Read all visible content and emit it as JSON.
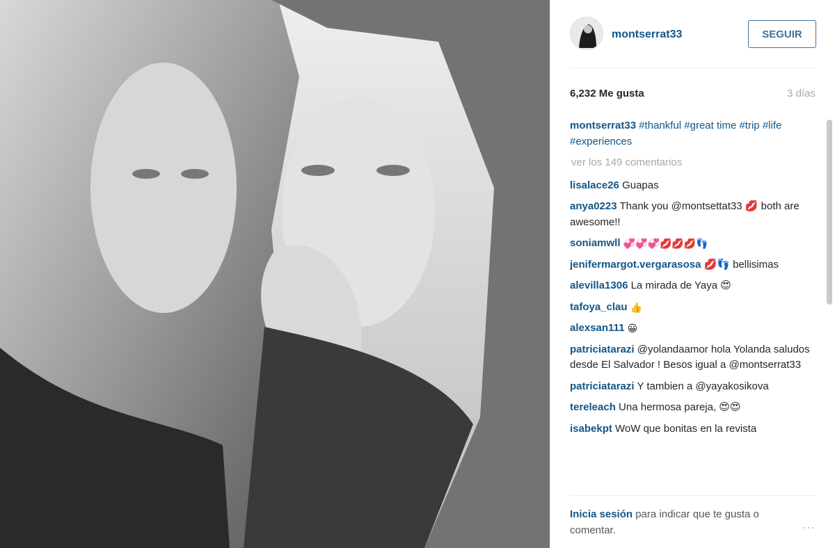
{
  "post": {
    "username": "montserrat33",
    "follow_label": "SEGUIR",
    "likes": "6,232 Me gusta",
    "time_ago": "3 días"
  },
  "caption": {
    "user": "montserrat33",
    "line": "#thankful #great time #trip #life #experiences"
  },
  "view_comments": "ver los 149 comentarios",
  "comments": [
    {
      "user": "lisalace26",
      "text": "Guapas"
    },
    {
      "user": "anya0223",
      "text": "Thank you @montsettat33 💋 both are awesome!!"
    },
    {
      "user": "soniamwll",
      "text": "💞💞💞💋💋💋👣"
    },
    {
      "user": "jenifermargot.vergarasosa",
      "text": "💋👣 bellisimas"
    },
    {
      "user": "alevilla1306",
      "text": "La mirada de Yaya 😍"
    },
    {
      "user": "tafoya_clau",
      "text": "👍"
    },
    {
      "user": "alexsan111",
      "text": "😀"
    },
    {
      "user": "patriciatarazi",
      "text": "@yolandaamor hola Yolanda saludos desde El Salvador ! Besos igual a @montserrat33"
    },
    {
      "user": "patriciatarazi",
      "text": "Y tambien a @yayakosikova"
    },
    {
      "user": "tereleach",
      "text": "Una hermosa pareja, 😍😍"
    },
    {
      "user": "isabekpt",
      "text": "WoW que bonitas en la revista"
    }
  ],
  "footer": {
    "login": "Inicia sesión",
    "text": "para indicar que te gusta o comentar.",
    "more": "…"
  },
  "colors": {
    "link": "#125688",
    "follow": "#3f729b",
    "muted": "#a5a7aa"
  }
}
